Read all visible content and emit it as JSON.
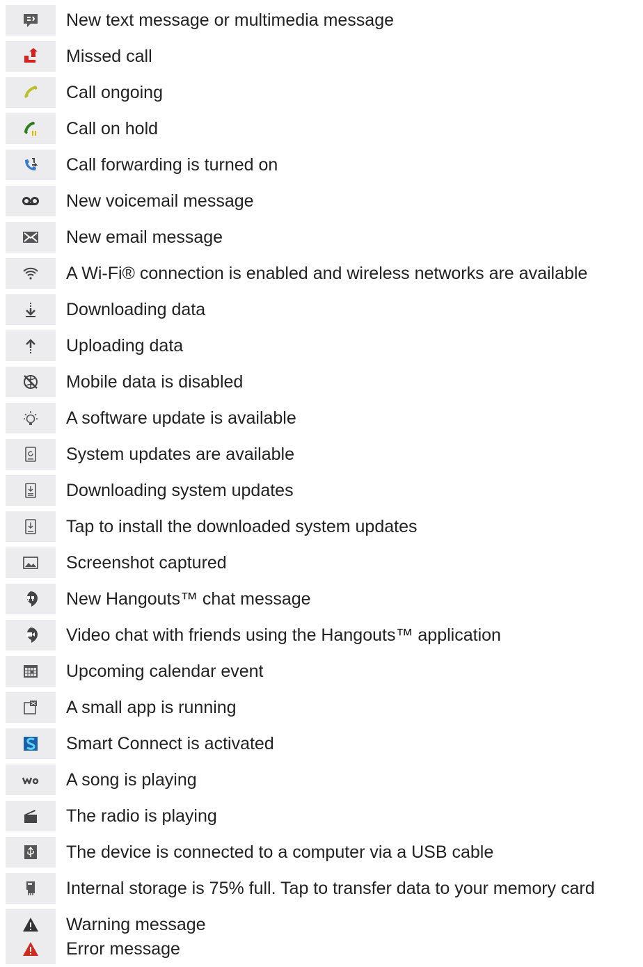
{
  "items": [
    {
      "icon": "message-icon",
      "label": "New text message or multimedia message"
    },
    {
      "icon": "missed-call-icon",
      "label": "Missed call"
    },
    {
      "icon": "call-ongoing-icon",
      "label": "Call ongoing"
    },
    {
      "icon": "call-on-hold-icon",
      "label": "Call on hold"
    },
    {
      "icon": "call-forwarding-icon",
      "label": "Call forwarding is turned on"
    },
    {
      "icon": "voicemail-icon",
      "label": "New voicemail message"
    },
    {
      "icon": "email-icon",
      "label": "New email message"
    },
    {
      "icon": "wifi-icon",
      "label": "A Wi-Fi® connection is enabled and wireless networks are available"
    },
    {
      "icon": "download-icon",
      "label": "Downloading data"
    },
    {
      "icon": "upload-icon",
      "label": "Uploading data"
    },
    {
      "icon": "mobile-data-disabled-icon",
      "label": "Mobile data is disabled"
    },
    {
      "icon": "software-update-icon",
      "label": "A software update is available"
    },
    {
      "icon": "system-update-icon",
      "label": "System updates are available"
    },
    {
      "icon": "downloading-system-update-icon",
      "label": "Downloading system updates"
    },
    {
      "icon": "install-update-icon",
      "label": "Tap to install the downloaded system updates"
    },
    {
      "icon": "screenshot-icon",
      "label": "Screenshot captured"
    },
    {
      "icon": "hangouts-chat-icon",
      "label": "New Hangouts™ chat message"
    },
    {
      "icon": "hangouts-video-icon",
      "label": "Video chat with friends using the Hangouts™ application"
    },
    {
      "icon": "calendar-icon",
      "label": "Upcoming calendar event"
    },
    {
      "icon": "small-app-icon",
      "label": "A small app is running"
    },
    {
      "icon": "smart-connect-icon",
      "label": "Smart Connect is activated"
    },
    {
      "icon": "walkman-icon",
      "label": "A song is playing"
    },
    {
      "icon": "radio-icon",
      "label": "The radio is playing"
    },
    {
      "icon": "usb-icon",
      "label": "The device is connected to a computer via a USB cable"
    },
    {
      "icon": "storage-icon",
      "label": "Internal storage is 75% full. Tap to transfer data to your memory card"
    },
    {
      "icon": "warning-icon",
      "label": "Warning message"
    },
    {
      "icon": "error-icon",
      "label": "Error message"
    }
  ],
  "colors": {
    "icon_background": "#ececef",
    "text": "#222222",
    "missed_call": "#d8201c",
    "call_ongoing": "#b8c02a",
    "call_hold": "#2e7d1f",
    "error": "#d32a1f",
    "icon_gray": "#555555"
  }
}
